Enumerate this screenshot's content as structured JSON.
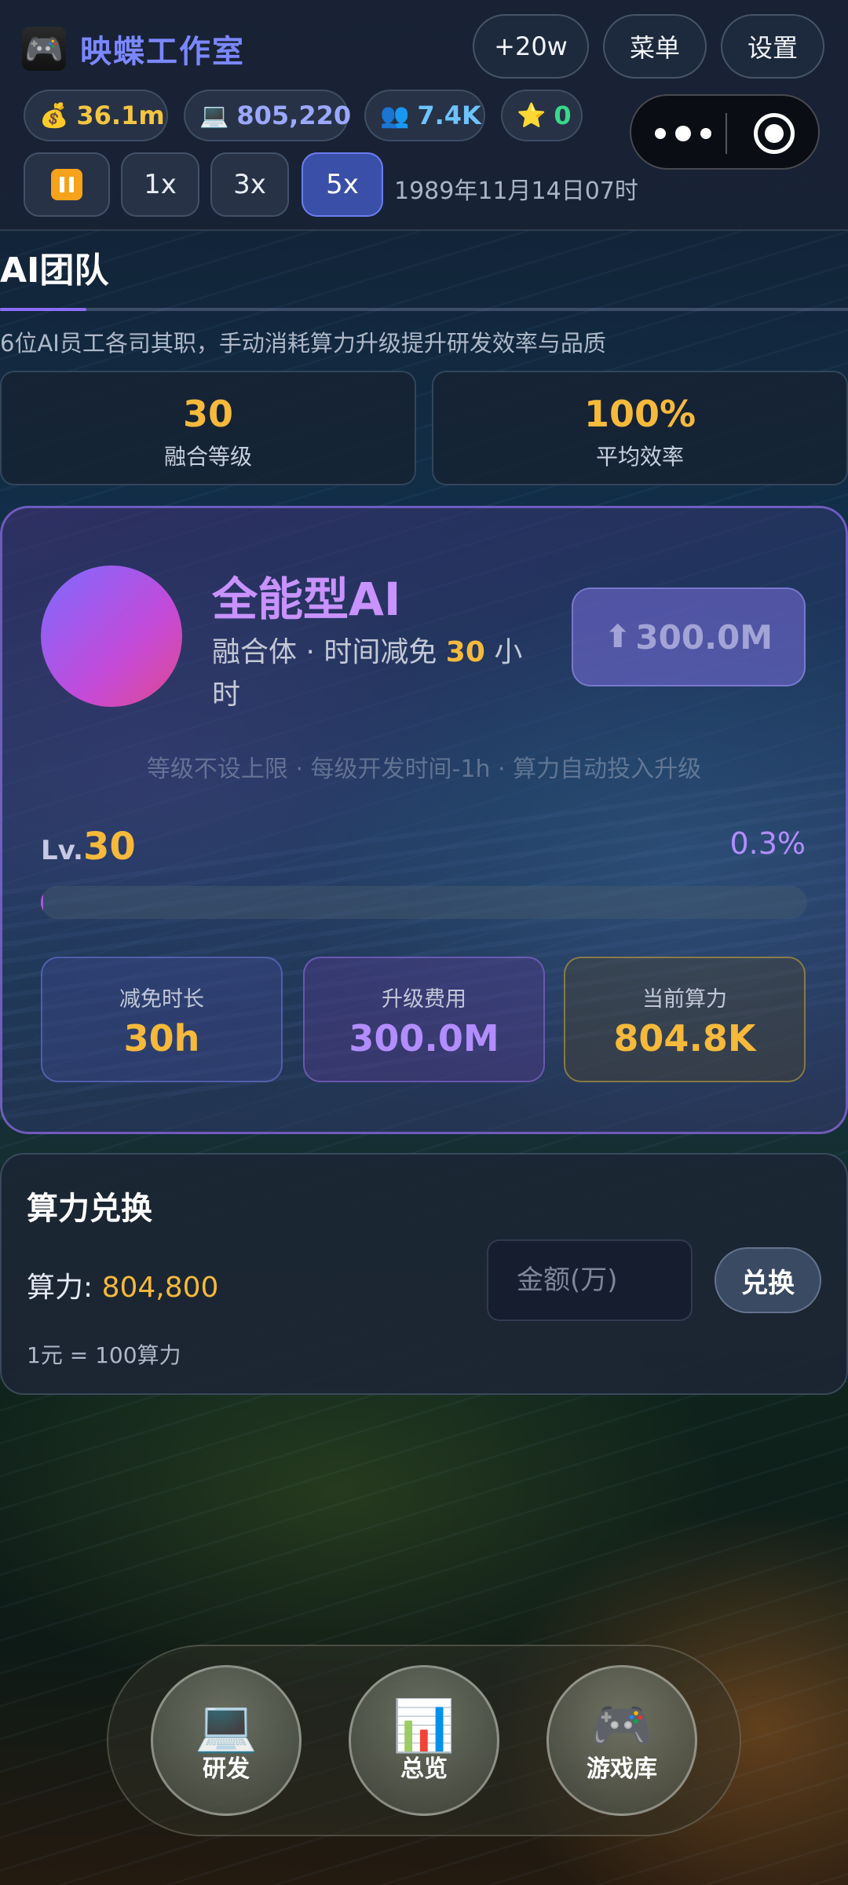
{
  "header": {
    "brand_icon": "gamepad-icon",
    "brand_emoji": "🎮",
    "title": "映蝶工作室",
    "buttons": {
      "plus": "+20w",
      "menu": "菜单",
      "settings": "设置"
    },
    "stats": {
      "money": {
        "icon": "💰",
        "value": "36.1m"
      },
      "compute": {
        "icon": "💻",
        "value": "805,220"
      },
      "fans": {
        "icon": "👥",
        "value": "7.4K"
      },
      "stars": {
        "icon": "⭐",
        "value": "0"
      }
    },
    "speed": {
      "one": "1x",
      "three": "3x",
      "five": "5x",
      "selected": "5x"
    },
    "date": "1989年11月14日07时"
  },
  "section": {
    "title": "AI团队",
    "desc": "6位AI员工各司其职，手动消耗算力升级提升研发效率与品质",
    "summary": [
      {
        "value": "30",
        "label": "融合等级"
      },
      {
        "value": "100%",
        "label": "平均效率"
      }
    ]
  },
  "fusion": {
    "name": "全能型AI",
    "sub_prefix": "融合体 · 时间减免 ",
    "sub_value": "30",
    "sub_suffix": " 小时",
    "upgrade_label": "300.0M",
    "note": "等级不设上限 · 每级开发时间-1h · 算力自动投入升级",
    "level_prefix": "Lv.",
    "level": "30",
    "progress_text": "0.3%",
    "progress": 0.003,
    "cards": {
      "reduce": {
        "label": "减免时长",
        "value": "30h"
      },
      "cost": {
        "label": "升级费用",
        "value": "300.0M"
      },
      "compute": {
        "label": "当前算力",
        "value": "804.8K"
      }
    }
  },
  "exchange": {
    "title": "算力兑换",
    "balance_label": "算力: ",
    "balance_value": "804,800",
    "input_placeholder": "金额(万)",
    "button": "兑换",
    "rate": "1元 = 100算力"
  },
  "nav": {
    "research": {
      "icon": "💻",
      "label": "研发"
    },
    "overview": {
      "icon": "📊",
      "label": "总览"
    },
    "library": {
      "icon": "🎮",
      "label": "游戏库"
    }
  },
  "colors": {
    "accent_gold": "#f6b93b",
    "accent_purple": "#b28dff",
    "brand_blue": "#7b87ff",
    "selected_speed": "#3a4fa8"
  }
}
